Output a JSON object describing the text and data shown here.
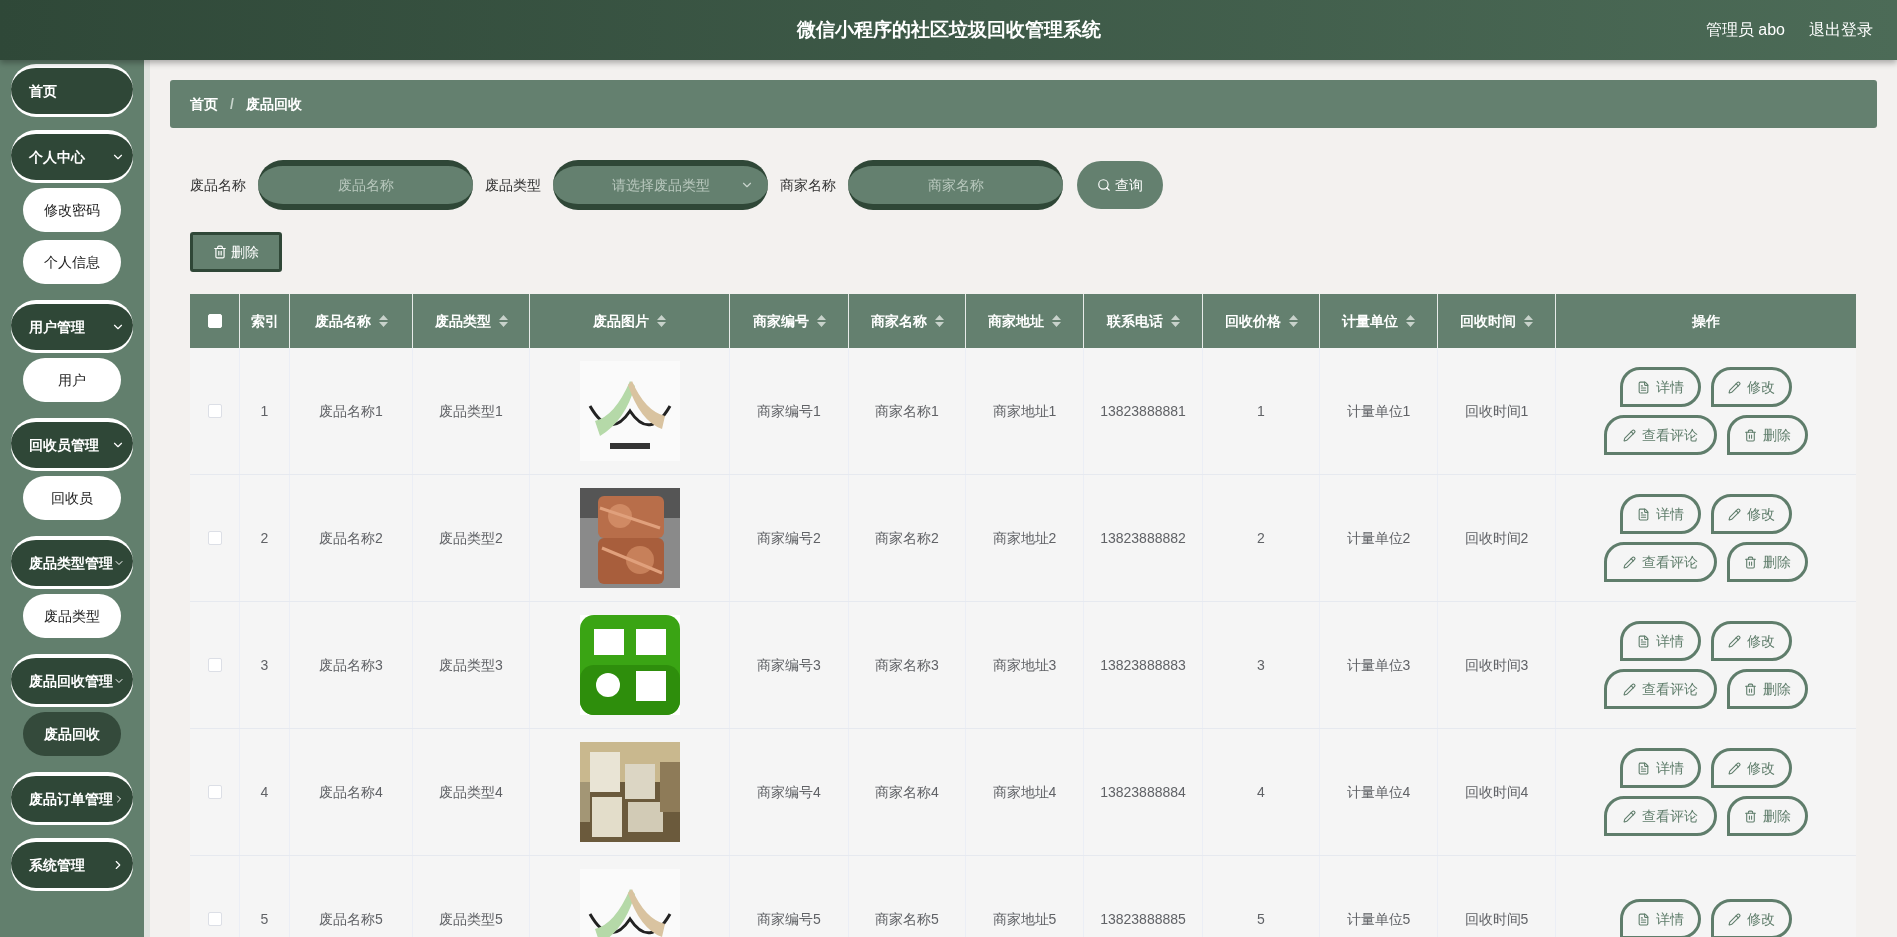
{
  "header": {
    "title": "微信小程序的社区垃圾回收管理系统",
    "user": "管理员 abo",
    "logout": "退出登录"
  },
  "sidebar": {
    "items": [
      {
        "kind": "link",
        "label": "首页"
      },
      {
        "kind": "group",
        "label": "个人中心",
        "expanded": true,
        "children": [
          {
            "label": "修改密码",
            "selected": false
          },
          {
            "label": "个人信息",
            "selected": false
          }
        ]
      },
      {
        "kind": "group",
        "label": "用户管理",
        "expanded": true,
        "children": [
          {
            "label": "用户",
            "selected": false
          }
        ]
      },
      {
        "kind": "group",
        "label": "回收员管理",
        "expanded": true,
        "children": [
          {
            "label": "回收员",
            "selected": false
          }
        ]
      },
      {
        "kind": "group",
        "label": "废品类型管理",
        "expanded": true,
        "children": [
          {
            "label": "废品类型",
            "selected": false
          }
        ]
      },
      {
        "kind": "group",
        "label": "废品回收管理",
        "expanded": true,
        "children": [
          {
            "label": "废品回收",
            "selected": true
          }
        ]
      },
      {
        "kind": "group",
        "label": "废品订单管理",
        "expanded": false
      },
      {
        "kind": "group",
        "label": "系统管理",
        "expanded": false
      }
    ]
  },
  "breadcrumb": {
    "items": [
      "首页",
      "废品回收"
    ],
    "separator": "/"
  },
  "search": {
    "fields": [
      {
        "kind": "input",
        "label": "废品名称",
        "placeholder": "废品名称"
      },
      {
        "kind": "select",
        "label": "废品类型",
        "placeholder": "请选择废品类型"
      },
      {
        "kind": "input",
        "label": "商家名称",
        "placeholder": "商家名称"
      }
    ],
    "button": "查询"
  },
  "delete_button": "删除",
  "table": {
    "columns": [
      {
        "label": "索引",
        "sortable": false
      },
      {
        "label": "废品名称",
        "sortable": true
      },
      {
        "label": "废品类型",
        "sortable": true
      },
      {
        "label": "废品图片",
        "sortable": true
      },
      {
        "label": "商家编号",
        "sortable": true
      },
      {
        "label": "商家名称",
        "sortable": true
      },
      {
        "label": "商家地址",
        "sortable": true
      },
      {
        "label": "联系电话",
        "sortable": true
      },
      {
        "label": "回收价格",
        "sortable": true
      },
      {
        "label": "计量单位",
        "sortable": true
      },
      {
        "label": "回收时间",
        "sortable": true
      },
      {
        "label": "操作",
        "sortable": false
      }
    ],
    "header_checked": false,
    "rows": [
      {
        "checked": false,
        "actions": [
          "详情",
          "修改",
          "查看评论",
          "删除"
        ],
        "cells": [
          "1",
          "废品名称1",
          "废品类型1",
          {
            "kind": "picture"
          },
          "商家编号1",
          "商家名称1",
          "商家地址1",
          "13823888881",
          "1",
          "计量单位1",
          "回收时间1"
        ]
      },
      {
        "checked": false,
        "actions": [
          "详情",
          "修改",
          "查看评论",
          "删除"
        ],
        "cells": [
          "2",
          "废品名称2",
          "废品类型2",
          {
            "kind": "picture"
          },
          "商家编号2",
          "商家名称2",
          "商家地址2",
          "13823888882",
          "2",
          "计量单位2",
          "回收时间2"
        ]
      },
      {
        "checked": false,
        "actions": [
          "详情",
          "修改",
          "查看评论",
          "删除"
        ],
        "cells": [
          "3",
          "废品名称3",
          "废品类型3",
          {
            "kind": "picture"
          },
          "商家编号3",
          "商家名称3",
          "商家地址3",
          "13823888883",
          "3",
          "计量单位3",
          "回收时间3"
        ]
      },
      {
        "checked": false,
        "actions": [
          "详情",
          "修改",
          "查看评论",
          "删除"
        ],
        "cells": [
          "4",
          "废品名称4",
          "废品类型4",
          {
            "kind": "picture"
          },
          "商家编号4",
          "商家名称4",
          "商家地址4",
          "13823888884",
          "4",
          "计量单位4",
          "回收时间4"
        ]
      },
      {
        "checked": false,
        "actions": [
          "详情",
          "修改"
        ],
        "cells": [
          "5",
          "废品名称5",
          "废品类型5",
          {
            "kind": "picture"
          },
          "商家编号5",
          "商家名称5",
          "商家地址5",
          "13823888885",
          "5",
          "计量单位5",
          "回收时间5"
        ]
      }
    ]
  }
}
